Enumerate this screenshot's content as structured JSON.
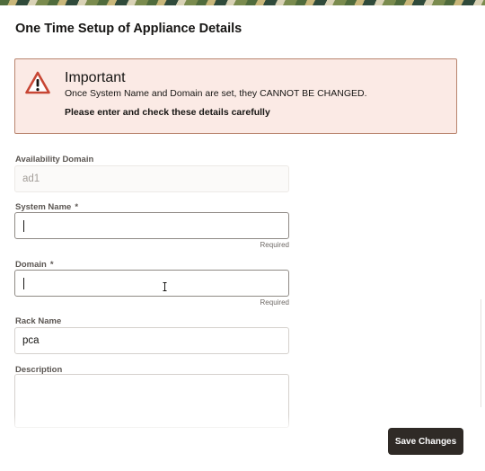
{
  "dialog": {
    "title": "One Time Setup of Appliance Details"
  },
  "alert": {
    "icon": "warning-triangle-icon",
    "heading": "Important",
    "message": "Once System Name and Domain are set, they CANNOT BE CHANGED.",
    "instruction": "Please enter and check these details carefully",
    "colors": {
      "background": "#fbeae5",
      "border": "#b9856f",
      "icon": "#c74634"
    }
  },
  "form": {
    "availability_domain": {
      "label": "Availability Domain",
      "value": "ad1"
    },
    "system_name": {
      "label": "System Name",
      "required_mark": "*",
      "value": "",
      "hint": "Required"
    },
    "domain": {
      "label": "Domain",
      "required_mark": "*",
      "value": "",
      "hint": "Required"
    },
    "rack_name": {
      "label": "Rack Name",
      "value": "pca"
    },
    "description": {
      "label": "Description",
      "value": ""
    }
  },
  "footer": {
    "save_label": "Save Changes",
    "save_color": "#2f2a26"
  }
}
